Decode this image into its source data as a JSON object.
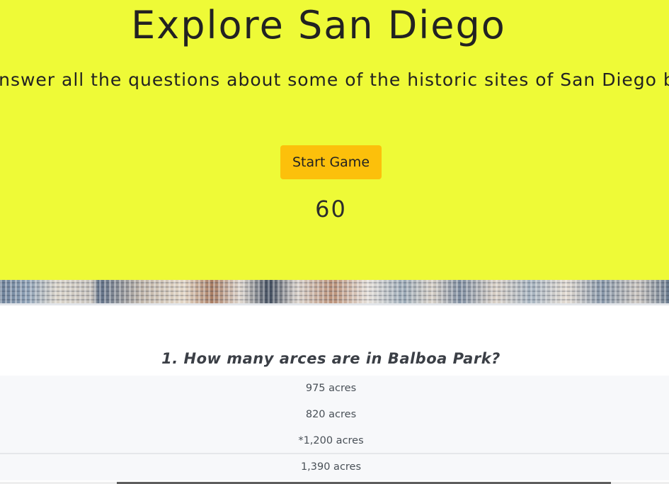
{
  "hero": {
    "title": "Explore San Diego",
    "intro": "Answer all the questions about some of the historic sites of San Diego before the time runs out!",
    "start_label": "Start Game",
    "timer": "60",
    "background_color": "#eefa37",
    "button_color": "#fcc00b"
  },
  "quiz": {
    "question": "1. How many arces are in Balboa Park?",
    "answers": [
      "975 acres",
      "820 acres",
      "*1,200 acres",
      "1,390 acres"
    ]
  }
}
